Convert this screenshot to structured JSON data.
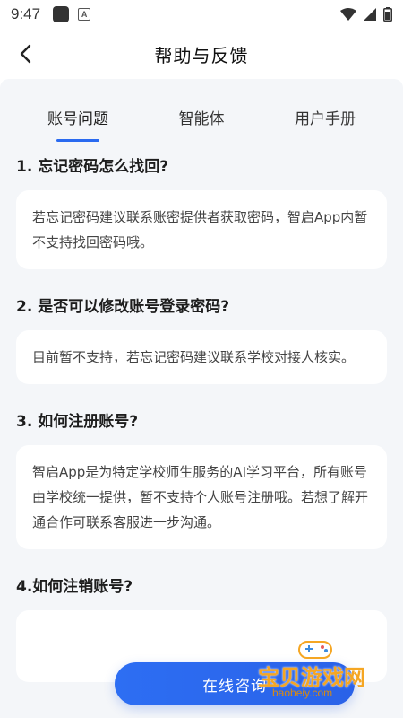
{
  "status_bar": {
    "time": "9:47",
    "icons": [
      "notification-square-icon",
      "a-badge-icon",
      "wifi-icon",
      "signal-icon",
      "battery-icon"
    ]
  },
  "header": {
    "title": "帮助与反馈",
    "back_icon": "chevron-left-icon"
  },
  "tabs": [
    {
      "label": "账号问题",
      "active": true
    },
    {
      "label": "智能体",
      "active": false
    },
    {
      "label": "用户手册",
      "active": false
    }
  ],
  "faq": [
    {
      "question": "1. 忘记密码怎么找回?",
      "answer": "若忘记密码建议联系账密提供者获取密码，智启App内暂不支持找回密码哦。"
    },
    {
      "question": "2. 是否可以修改账号登录密码?",
      "answer": "目前暂不支持，若忘记密码建议联系学校对接人核实。"
    },
    {
      "question": "3. 如何注册账号?",
      "answer": "智启App是为特定学校师生服务的AI学习平台，所有账号由学校统一提供，暂不支持个人账号注册哦。若想了解开通合作可联系客服进一步沟通。"
    },
    {
      "question": "4.如何注销账号?",
      "answer": ""
    }
  ],
  "consult_button": {
    "label": "在线咨询"
  },
  "watermark": {
    "text": "宝贝游戏网",
    "url": "baobeiy.com"
  },
  "colors": {
    "accent": "#2a6af0",
    "background": "#f4f6f9",
    "card": "#ffffff"
  }
}
